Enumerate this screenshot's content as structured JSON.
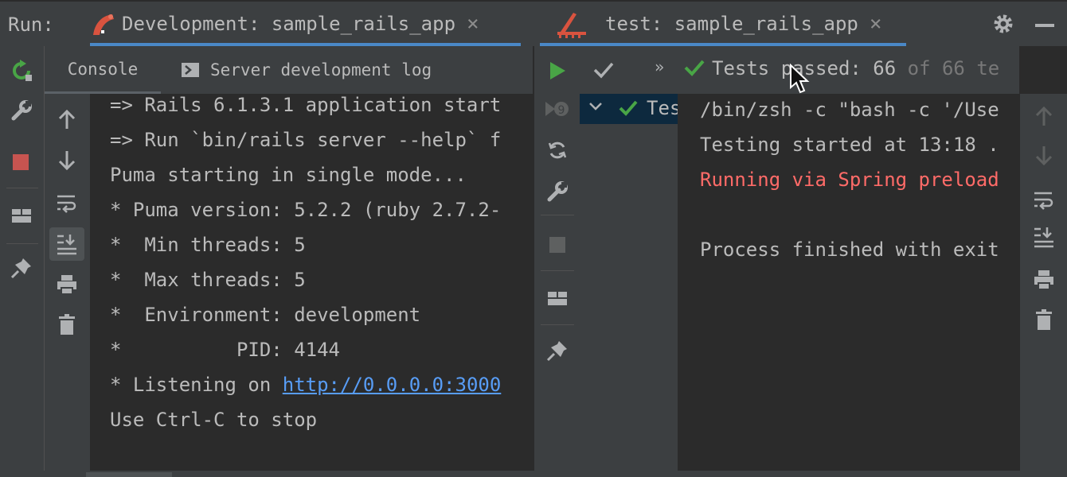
{
  "header": {
    "run_label": "Run:",
    "tab_dev": "Development: sample_rails_app",
    "tab_test": "test: sample_rails_app",
    "close_glyph": "×"
  },
  "dev_panel": {
    "subtabs": {
      "console": "Console",
      "server_log": "Server development log"
    },
    "console_lines": [
      "=> Rails 6.1.3.1 application start",
      "=> Run `bin/rails server --help` f",
      "Puma starting in single mode...",
      "* Puma version: 5.2.2 (ruby 2.7.2-",
      "*  Min threads: 5",
      "*  Max threads: 5",
      "*  Environment: development",
      "*          PID: 4144"
    ],
    "listening_prefix": "* Listening on ",
    "listening_url": "http://0.0.0.0:3000",
    "last_line": "Use Ctrl-C to stop"
  },
  "test_panel": {
    "status_prefix": "Tests passed: 66",
    "status_suffix": " of 66 te",
    "tree_root": "Tes",
    "output_lines": [
      "/bin/zsh -c \"bash -c '/Use",
      "Testing started at 13:18 ."
    ],
    "error_line": "Running via Spring preload",
    "process_line": "Process finished with exit"
  },
  "colors": {
    "accent": "#4a88c7",
    "pass_green": "#49a546",
    "stop_red": "#c75450",
    "error_text": "#ff6b68",
    "link": "#589df6"
  }
}
